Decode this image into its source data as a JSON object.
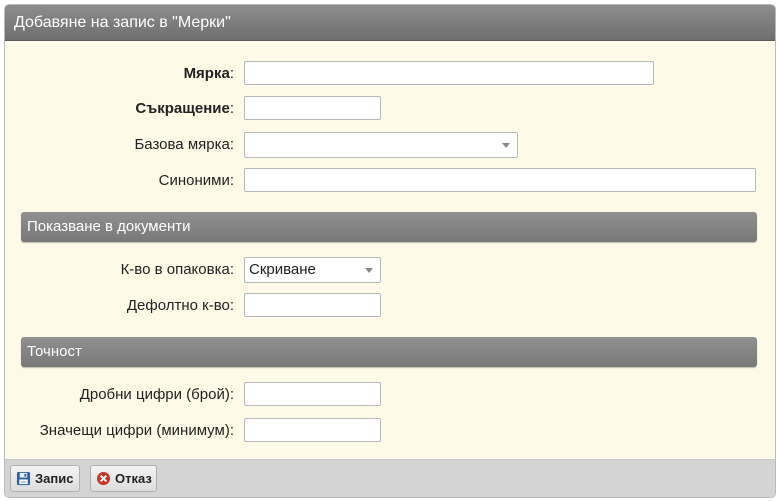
{
  "dialog": {
    "title": "Добавяне на запис в \"Мерки\""
  },
  "fields": {
    "measure": {
      "label": "Мярка",
      "suffix": ":",
      "value": ""
    },
    "abbreviation": {
      "label": "Съкращение",
      "suffix": ":",
      "value": ""
    },
    "base_measure": {
      "label": "Базова мярка:",
      "value": ""
    },
    "synonyms": {
      "label": "Синоними:",
      "value": ""
    }
  },
  "section_documents": {
    "title": "Показване в документи",
    "qty_in_package": {
      "label": "К-во в опаковка:",
      "value": "Скриване"
    },
    "default_qty": {
      "label": "Дефолтно к-во:",
      "value": ""
    }
  },
  "section_precision": {
    "title": "Точност",
    "fraction_digits": {
      "label": "Дробни цифри (брой):",
      "value": ""
    },
    "significant_digits": {
      "label": "Значещи цифри (минимум):",
      "value": ""
    }
  },
  "footer": {
    "save_label": "Запис",
    "cancel_label": "Отказ"
  },
  "colors": {
    "panel_bg": "#fdfbe8",
    "header_gray": "#7f7f7f",
    "cancel_red": "#c0392b",
    "save_blue": "#2f5f9e"
  },
  "icons": {
    "save": "floppy-disk-icon",
    "cancel": "cancel-circle-icon",
    "dropdown": "caret-down-icon"
  }
}
